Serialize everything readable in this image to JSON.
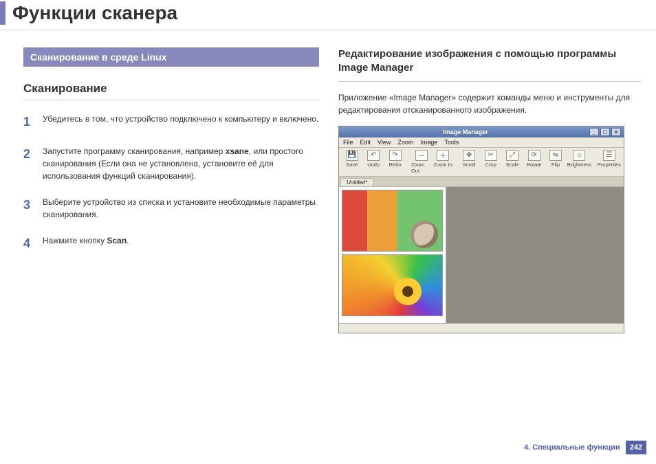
{
  "page": {
    "title": "Функции сканера"
  },
  "left": {
    "banner": "Сканирование в среде Linux",
    "subhead": "Сканирование",
    "steps": [
      {
        "n": "1",
        "text_pre": "Убедитесь в том, что устройство подключено к компьютеру и включено.",
        "bold": "",
        "text_post": ""
      },
      {
        "n": "2",
        "text_pre": "Запустите программу сканирования, например ",
        "bold": "xsane",
        "text_post": ", или простого сканирования (Если она не установлена, установите её для использования функций сканирования)."
      },
      {
        "n": "3",
        "text_pre": "Выберите устройство из списка и установите необходимые параметры сканирования.",
        "bold": "",
        "text_post": ""
      },
      {
        "n": "4",
        "text_pre": "Нажмите кнопку ",
        "bold": "Scan",
        "text_post": "."
      }
    ]
  },
  "right": {
    "heading": "Редактирование изображения с помощью программы Image Manager",
    "intro": "Приложение «Image Manager» содержит команды меню и инструменты для редактирования отсканированного изображения."
  },
  "window": {
    "title": "Image Manager",
    "menus": [
      "File",
      "Edit",
      "View",
      "Zoom",
      "Image",
      "Tools"
    ],
    "tools": [
      {
        "label": "Save",
        "glyph": "💾"
      },
      {
        "label": "Undo",
        "glyph": "↶"
      },
      {
        "label": "Redo",
        "glyph": "↷"
      },
      {
        "label": "Zoom Out",
        "glyph": "－"
      },
      {
        "label": "Zoom In",
        "glyph": "＋"
      },
      {
        "label": "Scroll",
        "glyph": "✥"
      },
      {
        "label": "Crop",
        "glyph": "✂"
      },
      {
        "label": "Scale",
        "glyph": "⤢"
      },
      {
        "label": "Rotate",
        "glyph": "⟳"
      },
      {
        "label": "Flip",
        "glyph": "⇋"
      },
      {
        "label": "Brightness",
        "glyph": "☼"
      },
      {
        "label": "Properties",
        "glyph": "☰"
      }
    ],
    "tab": "Untitled*",
    "win_buttons": {
      "min": "_",
      "max": "□",
      "close": "×"
    }
  },
  "footer": {
    "chapter": "4.  Специальные функции",
    "page": "242"
  }
}
